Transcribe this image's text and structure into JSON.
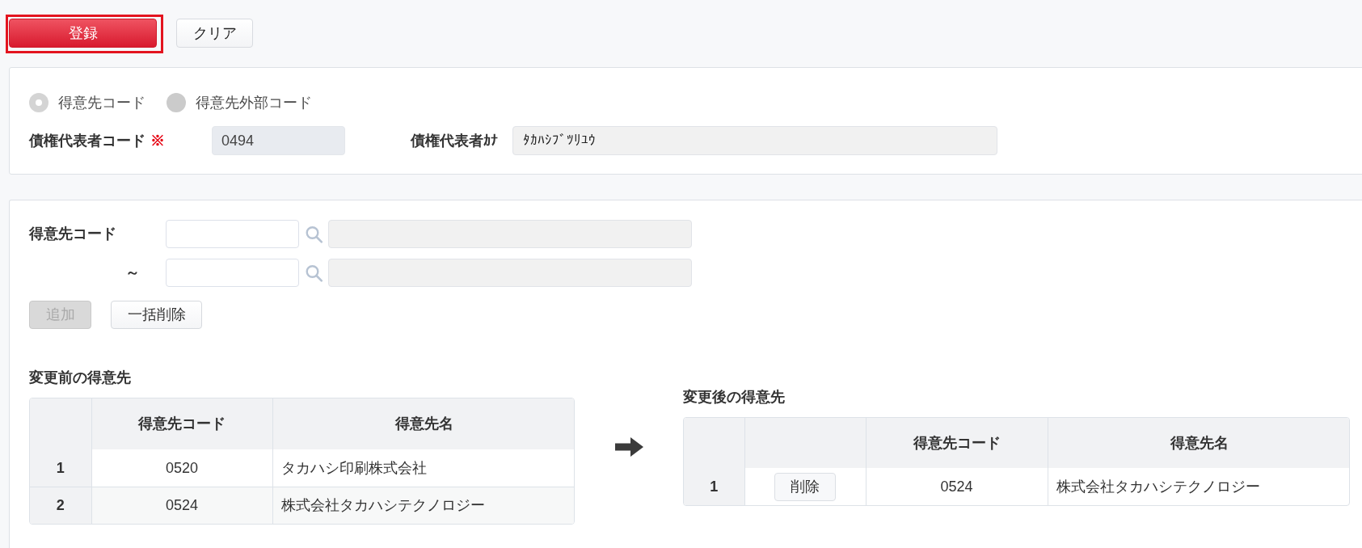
{
  "toolbar": {
    "buttons": [
      {
        "label": "登録",
        "kind": "primary",
        "highlighted": true
      },
      {
        "label": "クリア",
        "kind": "secondary",
        "highlighted": false
      }
    ]
  },
  "representative_panel": {
    "code_type_options": [
      {
        "label": "得意先コード",
        "selected": true
      },
      {
        "label": "得意先外部コード",
        "selected": false
      }
    ],
    "code_field": {
      "label": "債権代表者コード",
      "required_mark": "※",
      "value": "0494",
      "readonly": true
    },
    "kana_field": {
      "label": "債権代表者ｶﾅ",
      "value": "ﾀｶﾊｼﾌﾞﾂﾘﾕｳ"
    }
  },
  "customer_panel": {
    "range_rows": [
      {
        "kind": "label",
        "label": "得意先コード",
        "readonly": false
      },
      {
        "kind": "separator",
        "label": "～",
        "readonly": false
      }
    ],
    "buttons": [
      {
        "label": "追加",
        "disabled": true
      },
      {
        "label": "一括削除",
        "disabled": false
      }
    ],
    "before": {
      "title": "変更前の得意先",
      "columns": [
        "得意先コード",
        "得意先名"
      ],
      "rows": [
        {
          "index": "1",
          "code": "0520",
          "name": "タカハシ印刷株式会社"
        },
        {
          "index": "2",
          "code": "0524",
          "name": "株式会社タカハシテクノロジー"
        }
      ]
    },
    "after": {
      "title": "変更後の得意先",
      "columns": [
        "得意先コード",
        "得意先名"
      ],
      "rows": [
        {
          "index": "1",
          "action": "削除",
          "code": "0524",
          "name": "株式会社タカハシテクノロジー"
        }
      ]
    }
  }
}
